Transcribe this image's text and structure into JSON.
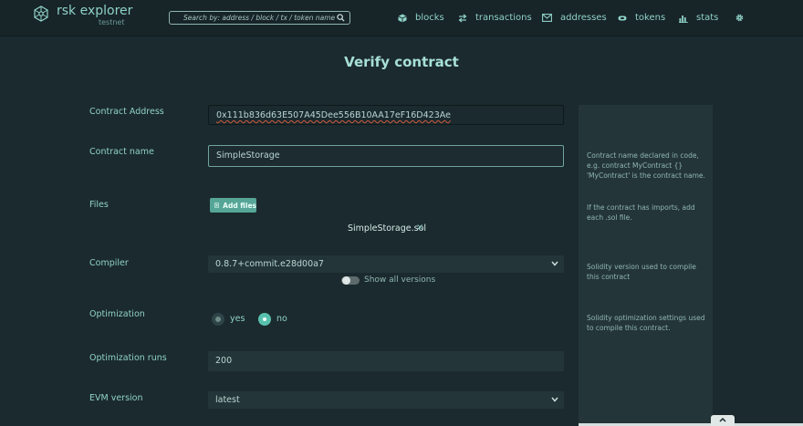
{
  "header": {
    "brand_name": "rsk explorer",
    "brand_sub": "testnet",
    "search_placeholder": "Search by: address / block / tx / token name",
    "nav": {
      "blocks": "blocks",
      "transactions": "transactions",
      "addresses": "addresses",
      "tokens": "tokens",
      "stats": "stats"
    }
  },
  "page": {
    "title": "Verify contract"
  },
  "form": {
    "contract_address": {
      "label": "Contract Address",
      "value": "0x111b836d63E507A45Dee556B10AA17eF16D423Ae"
    },
    "contract_name": {
      "label": "Contract name",
      "value": "SimpleStorage"
    },
    "files": {
      "label": "Files",
      "button": "Add files",
      "items": [
        "SimpleStorage.sol"
      ],
      "remove_glyph": "×"
    },
    "compiler": {
      "label": "Compiler",
      "value": "0.8.7+commit.e28d00a7",
      "toggle_label": "Show all versions",
      "toggle_on": false
    },
    "optimization": {
      "label": "Optimization",
      "options": [
        "yes",
        "no"
      ],
      "selected": "no"
    },
    "optimization_runs": {
      "label": "Optimization runs",
      "value": "200"
    },
    "evm_version": {
      "label": "EVM version",
      "value": "latest"
    }
  },
  "help": {
    "contract_name": "Contract name declared in code, e.g. contract MyContract {} 'MyContract' is the contract name.",
    "files": "If the contract has imports, add each .sol file.",
    "compiler": "Solidity version used to compile this contract",
    "optimization": "Solidity optimization settings used to compile this contract."
  },
  "colors": {
    "background": "#1b2a2e",
    "accent": "#8fd2c6",
    "button": "#56a697",
    "radio_selected": "#58c1ae"
  }
}
